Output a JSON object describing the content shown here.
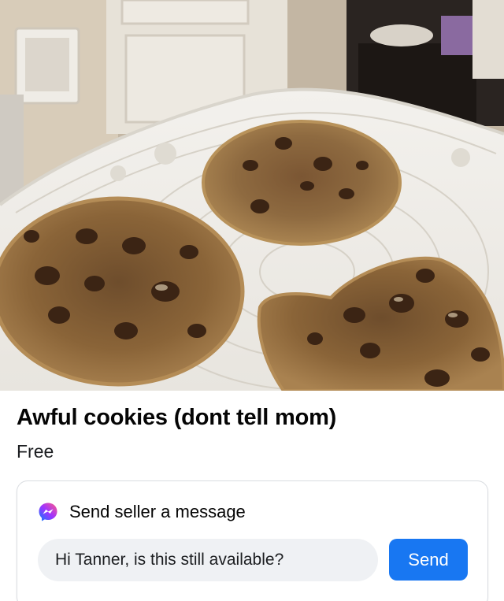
{
  "listing": {
    "title": "Awful cookies (dont tell mom)",
    "price": "Free"
  },
  "photo": {
    "subject": "cookies-on-plate"
  },
  "message_card": {
    "icon": "messenger-icon",
    "heading": "Send seller a message",
    "input_value": "Hi Tanner, is this still available?",
    "send_label": "Send"
  },
  "colors": {
    "accent": "#1877f2",
    "input_bg": "#eff1f4",
    "text": "#050505"
  }
}
